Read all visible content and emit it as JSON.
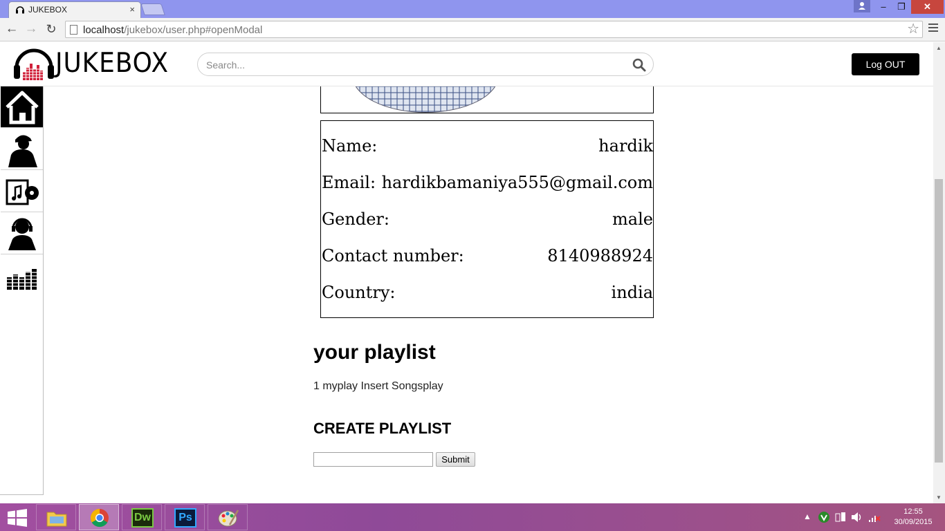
{
  "browser": {
    "tab_title": "JUKEBOX",
    "tab_close": "×",
    "url_host": "localhost",
    "url_path": "/jukebox/user.php#openModal",
    "star": "☆"
  },
  "header": {
    "logo_text": "JUKEBOX",
    "search_placeholder": "Search...",
    "logout_label": "Log OUT"
  },
  "sidebar": {
    "items": [
      {
        "icon": "home-icon",
        "active": true
      },
      {
        "icon": "artist-icon",
        "active": false
      },
      {
        "icon": "album-icon",
        "active": false
      },
      {
        "icon": "dj-icon",
        "active": false
      },
      {
        "icon": "equalizer-icon",
        "active": false
      }
    ]
  },
  "profile": {
    "rows": [
      {
        "label": "Name:",
        "value": "hardik"
      },
      {
        "label": "Email:",
        "value": "hardikbamaniya555@gmail.com"
      },
      {
        "label": "Gender:",
        "value": "male"
      },
      {
        "label": "Contact number:",
        "value": "8140988924"
      },
      {
        "label": "Country:",
        "value": "india"
      }
    ]
  },
  "playlist": {
    "title": "your playlist",
    "line": "1 myplay Insert Songsplay"
  },
  "create": {
    "title": "CREATE PLAYLIST",
    "input_value": "",
    "submit_label": "Submit"
  },
  "taskbar": {
    "clock_time": "12:55",
    "clock_date": "30/09/2015",
    "apps": [
      "file-explorer",
      "chrome",
      "dreamweaver",
      "photoshop",
      "paint"
    ],
    "dw_label": "Dw",
    "ps_label": "Ps"
  }
}
